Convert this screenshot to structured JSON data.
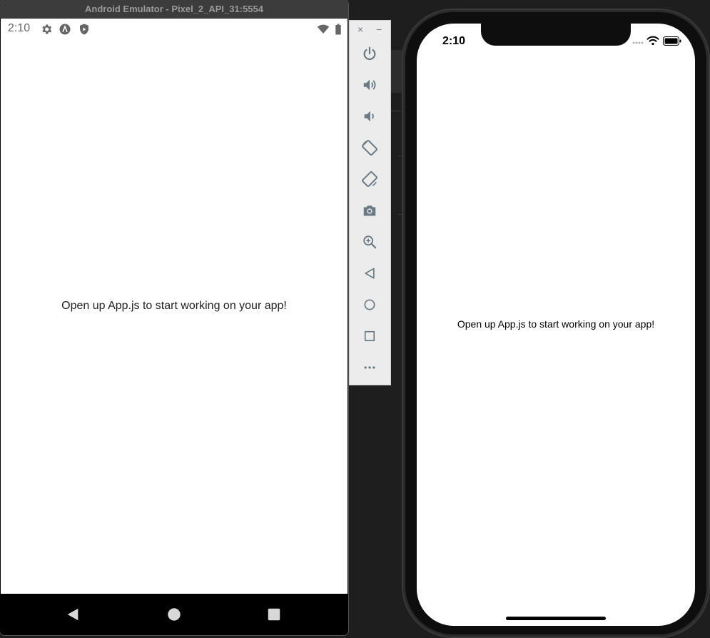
{
  "android": {
    "window_title": "Android Emulator - Pixel_2_API_31:5554",
    "status_time": "2:10",
    "message": "Open up App.js to start working on your app!"
  },
  "toolbar": {
    "close_label": "×",
    "minimize_label": "−",
    "tools": [
      "power",
      "volume-up",
      "volume-down",
      "rotate-left",
      "rotate-right",
      "take-screenshot",
      "zoom",
      "back",
      "home",
      "overview",
      "more"
    ]
  },
  "ios": {
    "status_time": "2:10",
    "message": "Open up App.js to start working on your app!"
  },
  "colors": {
    "toolbar_icon": "#6a7a82",
    "android_status_icon": "#666666",
    "titlebar_bg": "#3c3c3c"
  }
}
